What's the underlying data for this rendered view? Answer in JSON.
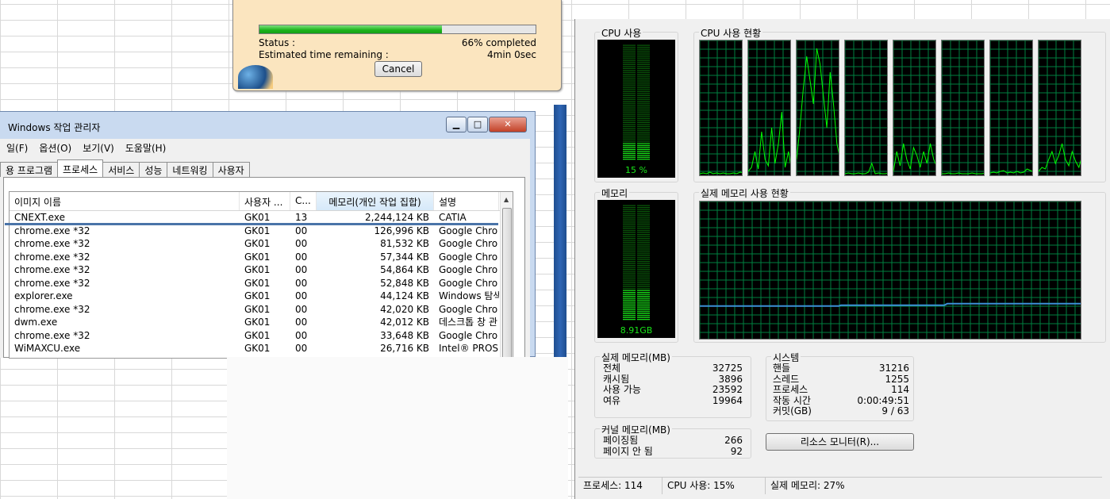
{
  "progress_dialog": {
    "percent": 66,
    "status_label": "Status :",
    "status_value": "66% completed",
    "eta_label": "Estimated time remaining :",
    "eta_value": "4min 0sec",
    "cancel_label": "Cancel"
  },
  "task_manager": {
    "title": "Windows 작업 관리자",
    "menu": [
      "일(F)",
      "옵션(O)",
      "보기(V)",
      "도움말(H)"
    ],
    "tabs": [
      "용 프로그램",
      "프로세스",
      "서비스",
      "성능",
      "네트워킹",
      "사용자"
    ],
    "active_tab": 1,
    "columns": [
      "이미지 이름",
      "사용자 ...",
      "C...",
      "메모리(개인 작업 집합)",
      "설명"
    ],
    "rows": [
      [
        "CNEXT.exe",
        "GK01",
        "13",
        "2,244,124 KB",
        "CATIA"
      ],
      [
        "chrome.exe *32",
        "GK01",
        "00",
        "126,996 KB",
        "Google Chro"
      ],
      [
        "chrome.exe *32",
        "GK01",
        "00",
        "81,532 KB",
        "Google Chro"
      ],
      [
        "chrome.exe *32",
        "GK01",
        "00",
        "57,344 KB",
        "Google Chro"
      ],
      [
        "chrome.exe *32",
        "GK01",
        "00",
        "54,864 KB",
        "Google Chro"
      ],
      [
        "chrome.exe *32",
        "GK01",
        "00",
        "52,848 KB",
        "Google Chro"
      ],
      [
        "explorer.exe",
        "GK01",
        "00",
        "44,124 KB",
        "Windows 탐색"
      ],
      [
        "chrome.exe *32",
        "GK01",
        "00",
        "42,020 KB",
        "Google Chro"
      ],
      [
        "dwm.exe",
        "GK01",
        "00",
        "42,012 KB",
        "데스크톱 창 관"
      ],
      [
        "chrome.exe *32",
        "GK01",
        "00",
        "33,648 KB",
        "Google Chro"
      ],
      [
        "WiMAXCU.exe",
        "GK01",
        "00",
        "26,716 KB",
        "Intel® PROS"
      ]
    ]
  },
  "performance": {
    "cpu_usage_caption": "CPU 사용",
    "cpu_usage_value": "15 %",
    "cpu_usage_percent": 15,
    "cpu_history_caption": "CPU 사용 현황",
    "cpu_core_count": 8,
    "memory_caption": "메모리",
    "memory_value": "8.91GB",
    "memory_percent": 27,
    "memory_history_caption": "실제 메모리 사용 현황",
    "physical_memory": {
      "caption": "실제 메모리(MB)",
      "items": [
        [
          "전체",
          "32725"
        ],
        [
          "캐시됨",
          "3896"
        ],
        [
          "사용 가능",
          "23592"
        ],
        [
          "여유",
          "19964"
        ]
      ]
    },
    "system": {
      "caption": "시스템",
      "items": [
        [
          "핸들",
          "31216"
        ],
        [
          "스레드",
          "1255"
        ],
        [
          "프로세스",
          "114"
        ],
        [
          "작동 시간",
          "0:00:49:51"
        ],
        [
          "커밋(GB)",
          "9 / 63"
        ]
      ]
    },
    "kernel_memory": {
      "caption": "커널 메모리(MB)",
      "items": [
        [
          "페이징됨",
          "266"
        ],
        [
          "페이지 안 됨",
          "92"
        ]
      ]
    },
    "resource_monitor_label": "리소스 모니터(R)...",
    "colors": {
      "graph_line": "#00ff00",
      "grid": "#008040",
      "memory_line": "#3b8fd6"
    }
  },
  "status_bar": {
    "processes": "프로세스: 114",
    "cpu": "CPU 사용: 15%",
    "memory": "실제 메모리: 27%"
  }
}
